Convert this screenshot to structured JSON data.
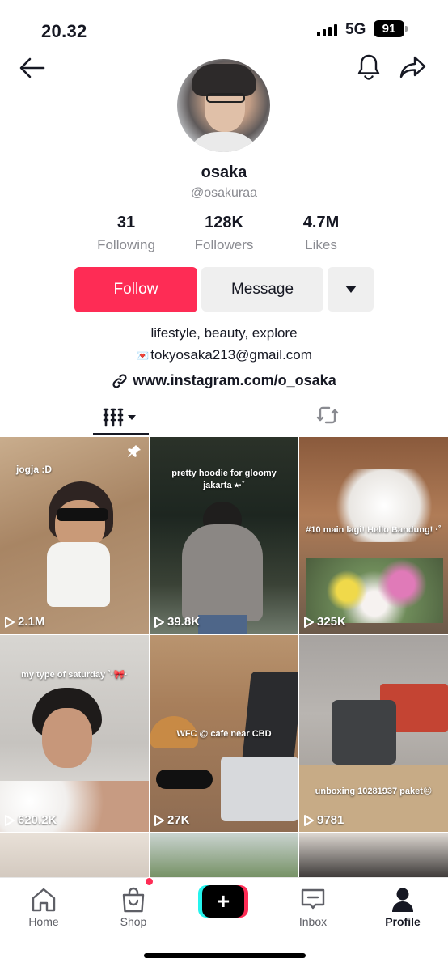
{
  "status_bar": {
    "time": "20.32",
    "network": "5G",
    "battery": "91"
  },
  "profile": {
    "name": "osaka",
    "handle": "@osakuraa",
    "stats": [
      {
        "value": "31",
        "label": "Following"
      },
      {
        "value": "128K",
        "label": "Followers"
      },
      {
        "value": "4.7M",
        "label": "Likes"
      }
    ],
    "follow_label": "Follow",
    "message_label": "Message",
    "bio_line1": "lifestyle, beauty, explore",
    "bio_email": "tokyosaka213@gmail.com",
    "bio_link": "www.instagram.com/o_osaka"
  },
  "videos": [
    {
      "caption": "jogja :D",
      "views": "2.1M",
      "pinned": true
    },
    {
      "caption": "pretty hoodie for gloomy jakarta ⭑·˚",
      "views": "39.8K"
    },
    {
      "caption": "#10 main lagi! Hello Bandung! ·˚",
      "views": "325K"
    },
    {
      "caption": "my type of saturday ˚·🎀·",
      "views": "620.2K"
    },
    {
      "caption": "WFC @ cafe near CBD",
      "views": "27K"
    },
    {
      "caption": "unboxing 10281937 paket😣",
      "views": "9781"
    }
  ],
  "bottom_nav": {
    "home": "Home",
    "shop": "Shop",
    "inbox": "Inbox",
    "profile": "Profile"
  },
  "colors": {
    "accent": "#fe2c55",
    "cyan": "#25f4ee",
    "muted": "#8a8b91"
  }
}
